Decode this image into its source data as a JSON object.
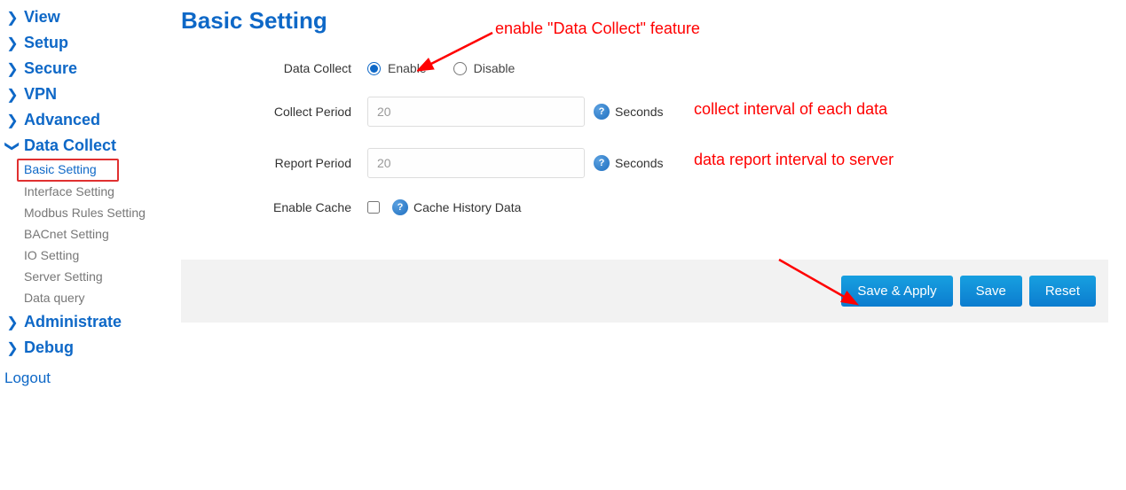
{
  "sidebar": {
    "items": [
      {
        "label": "View",
        "expanded": false
      },
      {
        "label": "Setup",
        "expanded": false
      },
      {
        "label": "Secure",
        "expanded": false
      },
      {
        "label": "VPN",
        "expanded": false
      },
      {
        "label": "Advanced",
        "expanded": false
      },
      {
        "label": "Data Collect",
        "expanded": true
      }
    ],
    "sub_items": [
      {
        "label": "Basic Setting",
        "active": true
      },
      {
        "label": "Interface Setting"
      },
      {
        "label": "Modbus Rules Setting"
      },
      {
        "label": "BACnet Setting"
      },
      {
        "label": "IO Setting"
      },
      {
        "label": "Server Setting"
      },
      {
        "label": "Data query"
      }
    ],
    "items_after": [
      {
        "label": "Administrate",
        "expanded": false
      },
      {
        "label": "Debug",
        "expanded": false
      }
    ],
    "logout": "Logout"
  },
  "main": {
    "title": "Basic Setting",
    "fields": {
      "data_collect": {
        "label": "Data Collect",
        "enable": "Enable",
        "disable": "Disable",
        "selected": "enable"
      },
      "collect_period": {
        "label": "Collect Period",
        "value": "20",
        "unit": "Seconds"
      },
      "report_period": {
        "label": "Report Period",
        "value": "20",
        "unit": "Seconds"
      },
      "enable_cache": {
        "label": "Enable Cache",
        "desc": "Cache History Data",
        "checked": false
      }
    },
    "buttons": {
      "save_apply": "Save & Apply",
      "save": "Save",
      "reset": "Reset"
    }
  },
  "annotations": {
    "enable_note": "enable \"Data Collect\" feature",
    "collect_note": "collect interval of each data",
    "report_note": "data report interval to server"
  }
}
